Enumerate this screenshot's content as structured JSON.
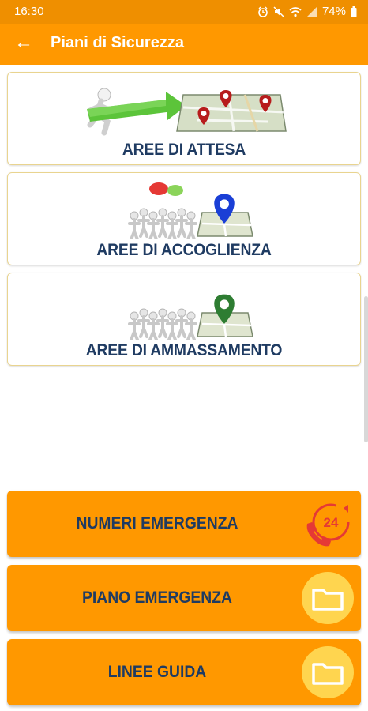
{
  "status_bar": {
    "time": "16:30",
    "battery": "74%"
  },
  "app_bar": {
    "title": "Piani di Sicurezza"
  },
  "areas": [
    {
      "label": "AREE DI ATTESA",
      "pin_color": "#b71c1c"
    },
    {
      "label": "AREE DI ACCOGLIENZA",
      "pin_color": "#1a3fd6"
    },
    {
      "label": "AREE DI AMMASSAMENTO",
      "pin_color": "#2e7d32"
    }
  ],
  "buttons": [
    {
      "label": "NUMERI EMERGENZA",
      "icon": "phone-24h-icon",
      "icon_text": "24"
    },
    {
      "label": "PIANO EMERGENZA",
      "icon": "folder-icon"
    },
    {
      "label": "LINEE GUIDA",
      "icon": "folder-icon"
    }
  ],
  "colors": {
    "accent": "#ff9800",
    "statusbar": "#ef8f00",
    "text_dark": "#1f3b62",
    "folder_circle": "#ffd54f"
  }
}
